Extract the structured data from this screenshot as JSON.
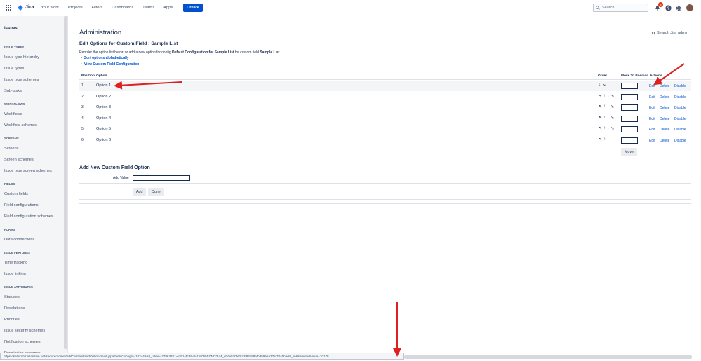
{
  "topnav": {
    "logo": "Jira",
    "menu": [
      {
        "label": "Your work",
        "chevron": true
      },
      {
        "label": "Projects",
        "chevron": true
      },
      {
        "label": "Filters",
        "chevron": true
      },
      {
        "label": "Dashboards",
        "chevron": true
      },
      {
        "label": "Teams",
        "chevron": true
      },
      {
        "label": "Apps",
        "chevron": true
      }
    ],
    "create_label": "Create",
    "search_placeholder": "Search",
    "notification_count": "2"
  },
  "sidebar": {
    "title": "Issues",
    "sections": [
      {
        "heading": "ISSUE TYPES",
        "items": [
          "Issue type hierarchy",
          "Issue types",
          "Issue type schemes",
          "Sub-tasks"
        ]
      },
      {
        "heading": "WORKFLOWS",
        "items": [
          "Workflows",
          "Workflow schemes"
        ]
      },
      {
        "heading": "SCREENS",
        "items": [
          "Screens",
          "Screen schemes",
          "Issue type screen schemes"
        ]
      },
      {
        "heading": "FIELDS",
        "items": [
          "Custom fields",
          "Field configurations",
          "Field configuration schemes"
        ]
      },
      {
        "heading": "FORMS",
        "items": [
          "Data connections"
        ]
      },
      {
        "heading": "ISSUE FEATURES",
        "items": [
          "Time tracking",
          "Issue linking"
        ]
      },
      {
        "heading": "ISSUE ATTRIBUTES",
        "items": [
          "Statuses",
          "Resolutions",
          "Priorities",
          "Issue security schemes",
          "Notification schemes",
          "Permission schemes"
        ]
      }
    ]
  },
  "main": {
    "title": "Administration",
    "search_admin": "Search Jira admin",
    "section_title": "Edit Options for Custom Field : Sample List",
    "desc_prefix": "Reorder the option list below or add a new option for config ",
    "desc_config": "Default Configuration for Sample List",
    "desc_middle": " for custom field ",
    "desc_field": "Sample List",
    "links": [
      "Sort options alphabetically",
      "View Custom Field Configuration"
    ],
    "table": {
      "headers": {
        "position": "Position",
        "option": "Option",
        "order": "Order",
        "move_to": "Move To Position",
        "actions": "Actions"
      },
      "rows": [
        {
          "position": "1.",
          "option": "Option 1",
          "order": [
            "↓",
            "↘"
          ]
        },
        {
          "position": "2.",
          "option": "Option 2",
          "order": [
            "↖",
            "↑",
            "↓",
            "↘"
          ]
        },
        {
          "position": "3.",
          "option": "Option 3",
          "order": [
            "↖",
            "↑",
            "↓",
            "↘"
          ]
        },
        {
          "position": "4.",
          "option": "Option 4",
          "order": [
            "↖",
            "↑",
            "↓",
            "↘"
          ]
        },
        {
          "position": "5.",
          "option": "Option 5",
          "order": [
            "↖",
            "↑",
            "↓",
            "↘"
          ]
        },
        {
          "position": "6.",
          "option": "Option 6",
          "order": [
            "↖",
            "↑"
          ]
        }
      ],
      "action_labels": {
        "edit": "Edit",
        "delete": "Delete",
        "disable": "Disable"
      },
      "move_label": "Move"
    },
    "add_section": {
      "title": "Add New Custom Field Option",
      "label": "Add Value",
      "add_button": "Add",
      "done_button": "Done"
    }
  },
  "statusbar": {
    "url": "https://katekabir.atlassian.net/secure/admin/EditCustomFieldOptions!edit.jspa?fieldConfigId=10244&atl_token=27863321-e191-4c39-8a18-0b5574d23f44_cbde52bfe2f42f82c58efb359a5a37af784bbedd_lin&selectedValue=10178"
  },
  "colors": {
    "accent": "#0052cc",
    "arrow": "#e02020",
    "text": "#172b4d"
  }
}
